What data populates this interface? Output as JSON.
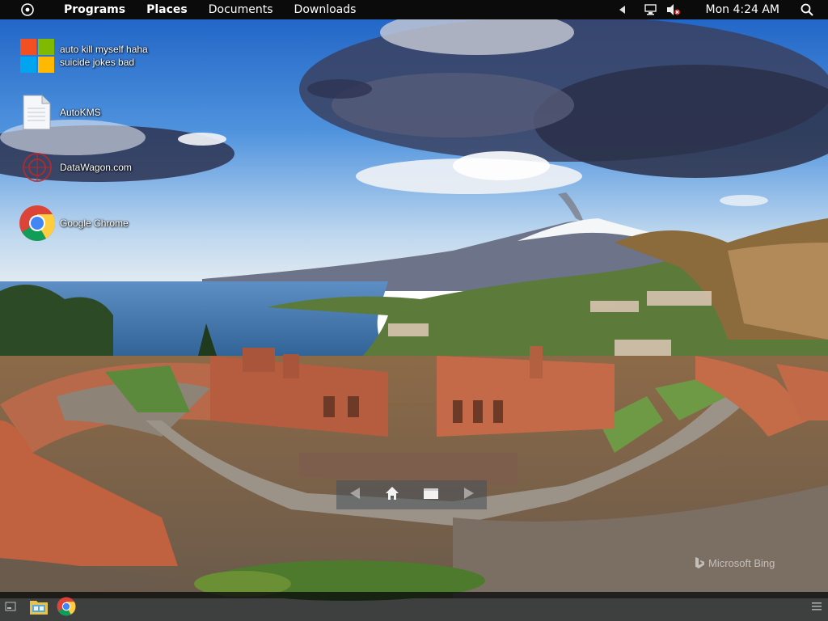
{
  "top_panel": {
    "menu": [
      "Programs",
      "Places",
      "Documents",
      "Downloads"
    ],
    "clock": "Mon 4:24 AM"
  },
  "desktop": {
    "icons": [
      {
        "label": "auto kill myself haha\nsuicide jokes bad",
        "icon": "windows-logo-icon"
      },
      {
        "label": "AutoKMS",
        "icon": "file-icon"
      },
      {
        "label": "DataWagon.com",
        "icon": "datawagon-icon"
      },
      {
        "label": "Google Chrome",
        "icon": "chrome-icon"
      }
    ]
  },
  "wallpaper": {
    "watermark": "Microsoft Bing"
  },
  "colors": {
    "panel_bg": "#0b0b0b",
    "sky_top": "#1c63c6",
    "sea": "#3a6ea8"
  }
}
